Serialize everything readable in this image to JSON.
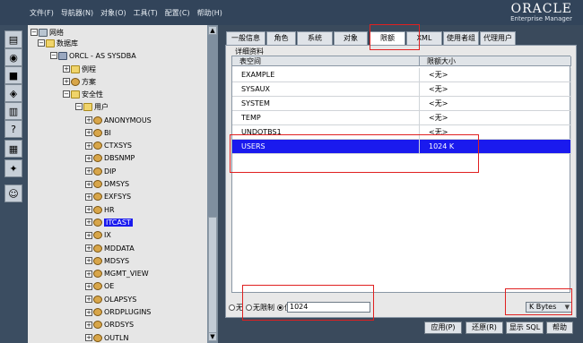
{
  "menu": [
    "文件(F)",
    "导航器(N)",
    "对象(O)",
    "工具(T)",
    "配置(C)",
    "帮助(H)"
  ],
  "brand": {
    "name": "ORACLE",
    "product": "Enterprise Manager"
  },
  "toolbar_icons": [
    "console-icon",
    "database-icon",
    "cube-icon",
    "group-icon",
    "trash-icon",
    "help-icon",
    "sql-icon",
    "network-icon",
    "people-icon"
  ],
  "tree": {
    "root": "网络",
    "databases": "数据库",
    "instance": "ORCL - AS SYSDBA",
    "routines": "例程",
    "schema": "方案",
    "security": "安全性",
    "users_folder": "用户",
    "users": [
      "ANONYMOUS",
      "BI",
      "CTXSYS",
      "DBSNMP",
      "DIP",
      "DMSYS",
      "EXFSYS",
      "HR",
      "ITCAST",
      "IX",
      "MDDATA",
      "MDSYS",
      "MGMT_VIEW",
      "OE",
      "OLAPSYS",
      "ORDPLUGINS",
      "ORDSYS",
      "OUTLN"
    ],
    "selected": "ITCAST"
  },
  "tabs": [
    "一般信息",
    "角色",
    "系统",
    "对象",
    "限额",
    "XML",
    "使用者组",
    "代理用户"
  ],
  "active_tab": "限额",
  "group_label": "详细资料",
  "grid": {
    "headers": [
      "表空间",
      "限额大小"
    ],
    "rows": [
      [
        "EXAMPLE",
        "<无>"
      ],
      [
        "SYSAUX",
        "<无>"
      ],
      [
        "SYSTEM",
        "<无>"
      ],
      [
        "TEMP",
        "<无>"
      ],
      [
        "UNDOTBS1",
        "<无>"
      ],
      [
        "USERS",
        "1024 K"
      ]
    ],
    "selected_row": 5
  },
  "quota": {
    "opt_none": "无",
    "opt_unlimited": "无限制",
    "opt_value": "值",
    "value": "1024",
    "unit": "K Bytes"
  },
  "buttons": {
    "apply": "应用(P)",
    "revert": "还原(R)",
    "show_sql": "显示 SQL",
    "help": "帮助"
  }
}
